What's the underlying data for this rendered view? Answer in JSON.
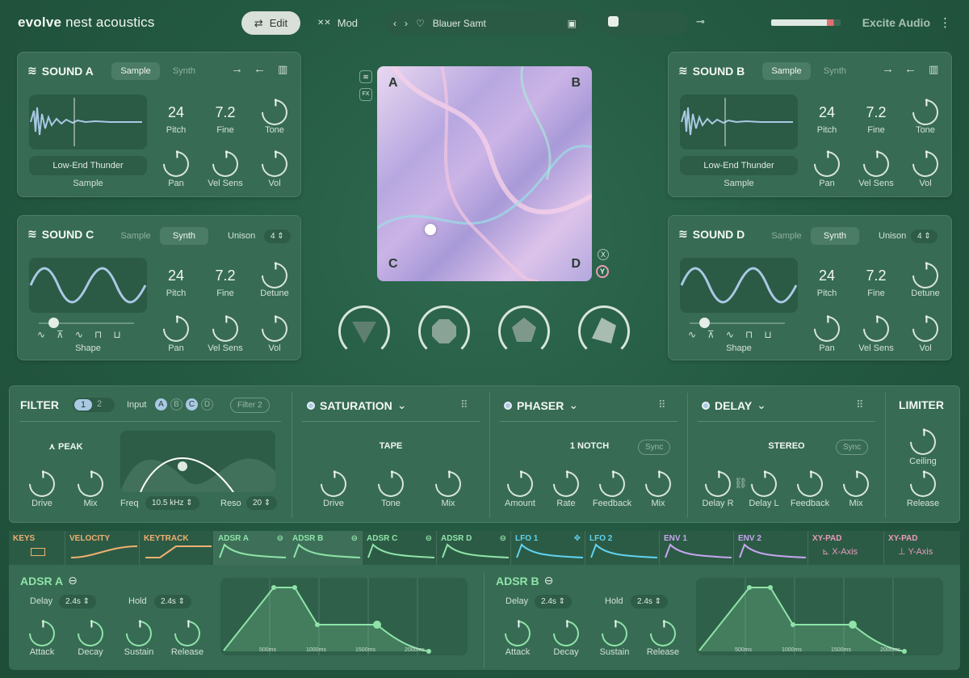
{
  "app": {
    "logo_bold": "evolve",
    "logo_rest": " nest acoustics",
    "edit": "Edit",
    "mod": "Mod",
    "preset": "Blauer Samt",
    "brand": "Excite Audio"
  },
  "soundA": {
    "title": "SOUND A",
    "tab1": "Sample",
    "tab2": "Synth",
    "pitch": "24",
    "fine": "7.2",
    "pitch_l": "Pitch",
    "fine_l": "Fine",
    "tone_l": "Tone",
    "sample_name": "Low-End Thunder",
    "sample_l": "Sample",
    "pan_l": "Pan",
    "vel_l": "Vel Sens",
    "vol_l": "Vol"
  },
  "soundB": {
    "title": "SOUND B",
    "tab1": "Sample",
    "tab2": "Synth",
    "pitch": "24",
    "fine": "7.2",
    "pitch_l": "Pitch",
    "fine_l": "Fine",
    "tone_l": "Tone",
    "sample_name": "Low-End Thunder",
    "sample_l": "Sample",
    "pan_l": "Pan",
    "vel_l": "Vel Sens",
    "vol_l": "Vol"
  },
  "soundC": {
    "title": "SOUND C",
    "tab1": "Sample",
    "tab2": "Synth",
    "unison_l": "Unison",
    "unison": "4",
    "pitch": "24",
    "fine": "7.2",
    "pitch_l": "Pitch",
    "fine_l": "Fine",
    "detune_l": "Detune",
    "shape_l": "Shape",
    "pan_l": "Pan",
    "vel_l": "Vel Sens",
    "vol_l": "Vol"
  },
  "soundD": {
    "title": "SOUND D",
    "tab1": "Sample",
    "tab2": "Synth",
    "unison_l": "Unison",
    "unison": "4",
    "pitch": "24",
    "fine": "7.2",
    "pitch_l": "Pitch",
    "fine_l": "Fine",
    "detune_l": "Detune",
    "shape_l": "Shape",
    "pan_l": "Pan",
    "vel_l": "Vel Sens",
    "vol_l": "Vol"
  },
  "xypad": {
    "a": "A",
    "b": "B",
    "c": "C",
    "d": "D",
    "x": "X",
    "y": "Y",
    "fx": "FX"
  },
  "filter": {
    "title": "FILTER",
    "n1": "1",
    "n2": "2",
    "input": "Input",
    "a": "A",
    "b": "B",
    "c": "C",
    "d": "D",
    "filter2": "Filter 2",
    "type": "PEAK",
    "drive": "Drive",
    "mix": "Mix",
    "freq_l": "Freq",
    "freq": "10.5 kHz",
    "reso_l": "Reso",
    "reso": "20"
  },
  "saturation": {
    "title": "SATURATION",
    "type": "TAPE",
    "drive": "Drive",
    "tone": "Tone",
    "mix": "Mix"
  },
  "phaser": {
    "title": "PHASER",
    "type": "1 NOTCH",
    "sync": "Sync",
    "amount": "Amount",
    "rate": "Rate",
    "feedback": "Feedback",
    "mix": "Mix"
  },
  "delay": {
    "title": "DELAY",
    "type": "STEREO",
    "sync": "Sync",
    "delayr": "Delay R",
    "delayl": "Delay L",
    "feedback": "Feedback",
    "mix": "Mix"
  },
  "limiter": {
    "title": "LIMITER",
    "ceiling": "Ceiling",
    "release": "Release"
  },
  "mod": {
    "keys": "KEYS",
    "velocity": "VELOCITY",
    "keytrack": "KEYTRACK",
    "adsra": "ADSR A",
    "adsrb": "ADSR B",
    "adsrc": "ADSR C",
    "adsrd": "ADSR D",
    "lfo1": "LFO 1",
    "lfo2": "LFO 2",
    "env1": "ENV 1",
    "env2": "ENV 2",
    "xy1": "XY-PAD",
    "xy2": "XY-PAD",
    "xaxis": "X-Axis",
    "yaxis": "Y-Axis"
  },
  "adsrA": {
    "title": "ADSR A",
    "delay_l": "Delay",
    "delay": "2.4s",
    "hold_l": "Hold",
    "hold": "2.4s",
    "attack": "Attack",
    "decay": "Decay",
    "sustain": "Sustain",
    "release": "Release",
    "t1": "500ms",
    "t2": "1000ms",
    "t3": "1500ms",
    "t4": "2000ms"
  },
  "adsrB": {
    "title": "ADSR B",
    "delay_l": "Delay",
    "delay": "2.4s",
    "hold_l": "Hold",
    "hold": "2.4s",
    "attack": "Attack",
    "decay": "Decay",
    "sustain": "Sustain",
    "release": "Release",
    "t1": "500ms",
    "t2": "1000ms",
    "t3": "1500ms",
    "t4": "2000ms"
  },
  "colors": {
    "bg": "#245a42",
    "accent": "#a9c9e4",
    "env": "#8fe3a8",
    "orange": "#f0b070",
    "cyan": "#5fd3f0",
    "purple": "#c6a6f0"
  }
}
